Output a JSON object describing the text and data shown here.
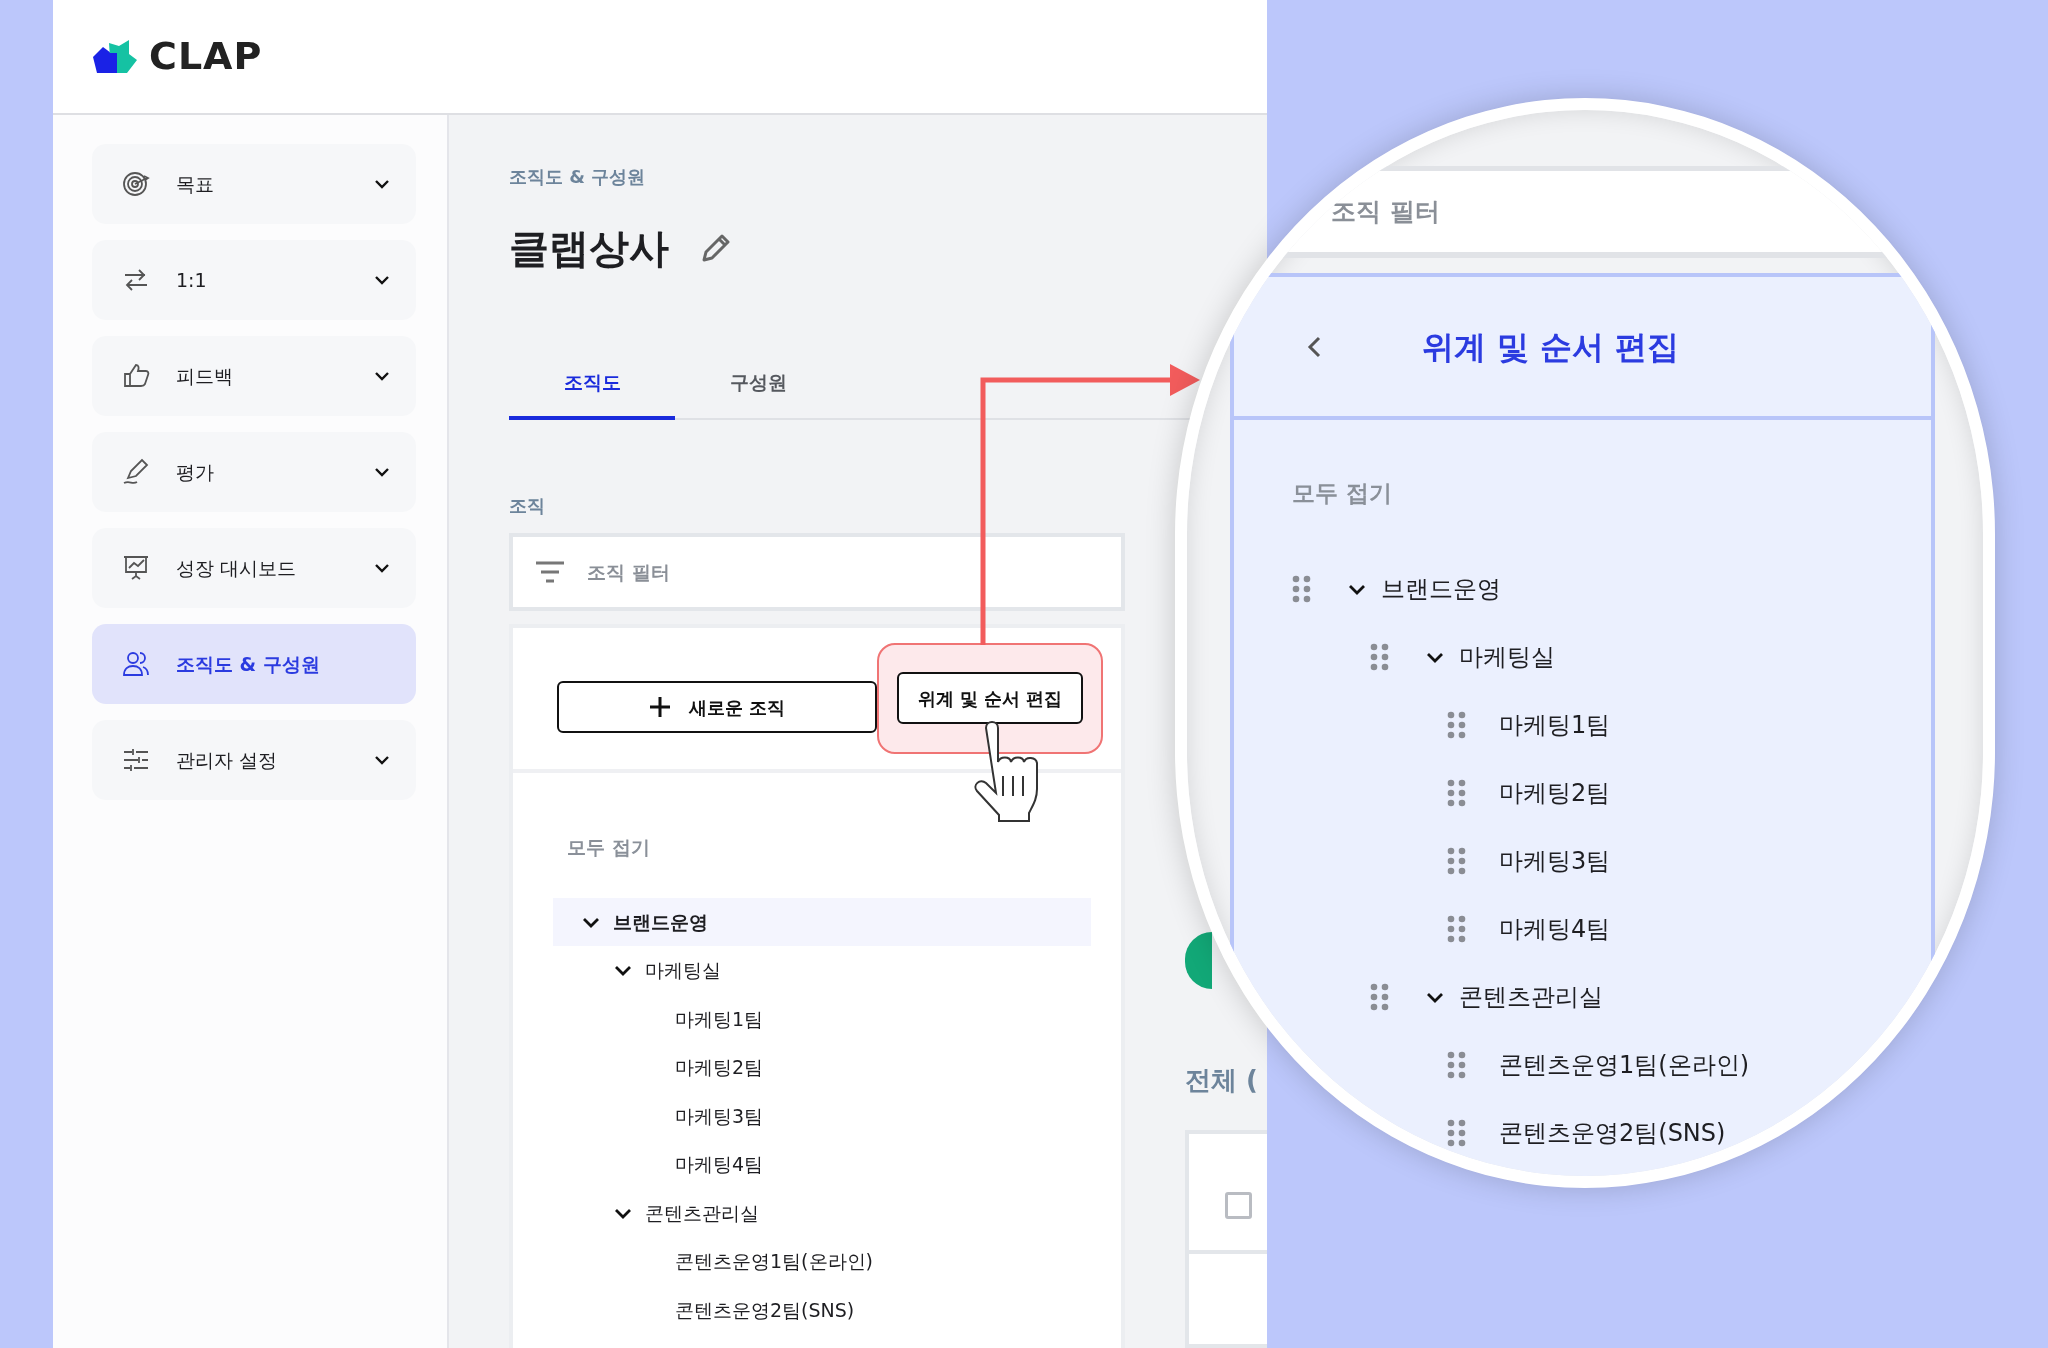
{
  "logo": {
    "text": "CLAP"
  },
  "sidebar": {
    "items": [
      {
        "label": "목표",
        "selected": false,
        "expandable": true
      },
      {
        "label": "1:1",
        "selected": false,
        "expandable": true
      },
      {
        "label": "피드백",
        "selected": false,
        "expandable": true
      },
      {
        "label": "평가",
        "selected": false,
        "expandable": true
      },
      {
        "label": "성장 대시보드",
        "selected": false,
        "expandable": true
      },
      {
        "label": "조직도 & 구성원",
        "selected": true,
        "expandable": false
      },
      {
        "label": "관리자 설정",
        "selected": false,
        "expandable": true
      }
    ]
  },
  "breadcrumb": "조직도 & 구성원",
  "title": "클랩상사",
  "tabs": [
    {
      "label": "조직도",
      "selected": true
    },
    {
      "label": "구성원",
      "selected": false
    }
  ],
  "section_label": "조직",
  "filter": {
    "placeholder": "조직 필터"
  },
  "buttons": [
    {
      "label": "새로운 조직",
      "kind": "add",
      "highlighted": false
    },
    {
      "label": "위계 및 순서 편집",
      "kind": "edit",
      "highlighted": true
    }
  ],
  "collapse_all": "모두 접기",
  "tree": [
    {
      "label": "브랜드운영",
      "selected": true,
      "expanded": true,
      "children": [
        {
          "label": "마케팅실",
          "selected": false,
          "expanded": true,
          "children": [
            {
              "label": "마케팅1팀",
              "selected": false
            },
            {
              "label": "마케팅2팀",
              "selected": false
            },
            {
              "label": "마케팅3팀",
              "selected": false
            },
            {
              "label": "마케팅4팀",
              "selected": false
            }
          ]
        },
        {
          "label": "콘텐츠관리실",
          "selected": false,
          "expanded": true,
          "children": [
            {
              "label": "콘텐츠운영1팀(온라인)",
              "selected": false
            },
            {
              "label": "콘텐츠운영2팀(SNS)",
              "selected": false
            }
          ]
        }
      ]
    }
  ],
  "members": {
    "title": "전체 (",
    "select_all_checked": false
  },
  "zoom_view": {
    "filter": {
      "placeholder": "조직 필터"
    },
    "title": "위계 및 순서 편집",
    "collapse_all": "모두 접기",
    "tree": [
      {
        "label": "브랜드운영",
        "expanded": true,
        "children": [
          {
            "label": "마케팅실",
            "expanded": true,
            "children": [
              {
                "label": "마케팅1팀"
              },
              {
                "label": "마케팅2팀"
              },
              {
                "label": "마케팅3팀"
              },
              {
                "label": "마케팅4팀"
              }
            ]
          },
          {
            "label": "콘텐츠관리실",
            "expanded": true,
            "children": [
              {
                "label": "콘텐츠운영1팀(온라인)"
              },
              {
                "label": "콘텐츠운영2팀(SNS)"
              }
            ]
          }
        ]
      }
    ]
  }
}
